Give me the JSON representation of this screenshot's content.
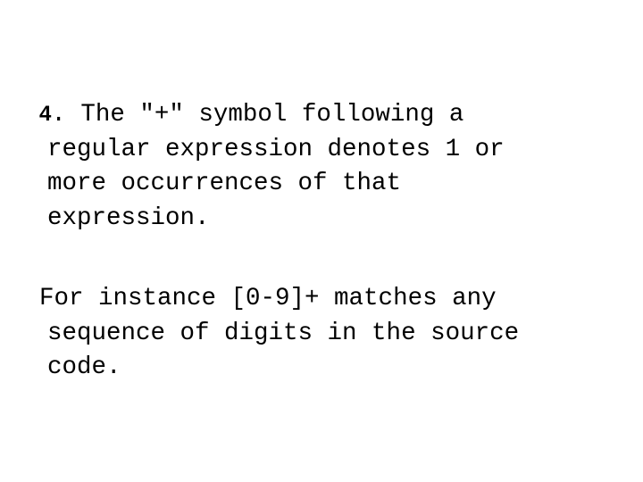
{
  "slide": {
    "item_number": "4",
    "paragraph1": {
      "first_line_rest": ". The \"+\" symbol following a",
      "lines": [
        "regular expression denotes 1 or",
        "more occurrences of that",
        "expression."
      ]
    },
    "paragraph2": {
      "lines": [
        "For instance [0-9]+ matches any",
        "sequence of digits in the source",
        "code."
      ]
    }
  }
}
